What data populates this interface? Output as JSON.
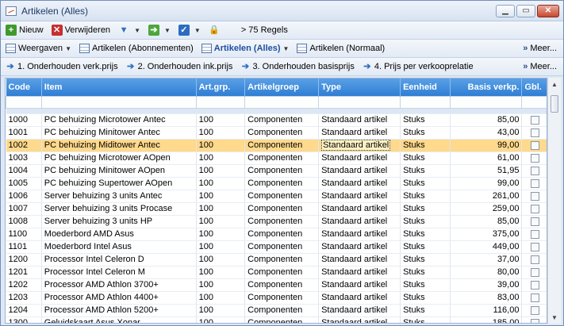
{
  "window": {
    "title": "Artikelen (Alles)"
  },
  "toolbar1": {
    "new_label": "Nieuw",
    "delete_label": "Verwijderen",
    "rows_label": "> 75 Regels"
  },
  "toolbar2": {
    "views_label": "Weergaven",
    "view1": "Artikelen (Abonnementen)",
    "view2": "Artikelen (Alles)",
    "view3": "Artikelen (Normaal)",
    "more": "Meer..."
  },
  "toolbar3": {
    "task1": "1. Onderhouden verk.prijs",
    "task2": "2. Onderhouden ink.prijs",
    "task3": "3. Onderhouden basisprijs",
    "task4": "4. Prijs per verkooprelatie",
    "more": "Meer..."
  },
  "grid": {
    "headers": [
      "Code",
      "Item",
      "Art.grp.",
      "Artikelgroep",
      "Type",
      "Eenheid",
      "Basis verkp.",
      "Gbl."
    ],
    "rows": [
      [
        "1000",
        "PC behuizing Microtower Antec",
        "100",
        "Componenten",
        "Standaard artikel",
        "Stuks",
        "85,00"
      ],
      [
        "1001",
        "PC behuizing Minitower Antec",
        "100",
        "Componenten",
        "Standaard artikel",
        "Stuks",
        "43,00"
      ],
      [
        "1002",
        "PC behuizing Miditower Antec",
        "100",
        "Componenten",
        "Standaard artikel",
        "Stuks",
        "99,00"
      ],
      [
        "1003",
        "PC behuizing Microtower AOpen",
        "100",
        "Componenten",
        "Standaard artikel",
        "Stuks",
        "61,00"
      ],
      [
        "1004",
        "PC behuizing Minitower AOpen",
        "100",
        "Componenten",
        "Standaard artikel",
        "Stuks",
        "51,95"
      ],
      [
        "1005",
        "PC behuizing Supertower AOpen",
        "100",
        "Componenten",
        "Standaard artikel",
        "Stuks",
        "99,00"
      ],
      [
        "1006",
        "Server behuizing 3 units Antec",
        "100",
        "Componenten",
        "Standaard artikel",
        "Stuks",
        "261,00"
      ],
      [
        "1007",
        "Server behuizing 3 units Procase",
        "100",
        "Componenten",
        "Standaard artikel",
        "Stuks",
        "259,00"
      ],
      [
        "1008",
        "Server behuizing 3 units HP",
        "100",
        "Componenten",
        "Standaard artikel",
        "Stuks",
        "85,00"
      ],
      [
        "1100",
        "Moederbord AMD Asus",
        "100",
        "Componenten",
        "Standaard artikel",
        "Stuks",
        "375,00"
      ],
      [
        "1101",
        "Moederbord Intel Asus",
        "100",
        "Componenten",
        "Standaard artikel",
        "Stuks",
        "449,00"
      ],
      [
        "1200",
        "Processor Intel Celeron D",
        "100",
        "Componenten",
        "Standaard artikel",
        "Stuks",
        "37,00"
      ],
      [
        "1201",
        "Processor Intel Celeron M",
        "100",
        "Componenten",
        "Standaard artikel",
        "Stuks",
        "80,00"
      ],
      [
        "1202",
        "Processor AMD Athlon 3700+",
        "100",
        "Componenten",
        "Standaard artikel",
        "Stuks",
        "39,00"
      ],
      [
        "1203",
        "Processor AMD Athlon 4400+",
        "100",
        "Componenten",
        "Standaard artikel",
        "Stuks",
        "83,00"
      ],
      [
        "1204",
        "Processor AMD Athlon 5200+",
        "100",
        "Componenten",
        "Standaard artikel",
        "Stuks",
        "116,00"
      ],
      [
        "1300",
        "Geluidskaart Asus Xonar",
        "100",
        "Componenten",
        "Standaard artikel",
        "Stuks",
        "185,00"
      ]
    ],
    "selected_row": 2
  }
}
